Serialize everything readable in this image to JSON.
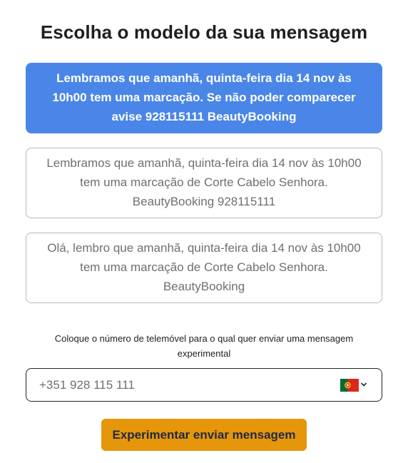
{
  "page": {
    "title": "Escolha o modelo da sua mensagem"
  },
  "templates": [
    {
      "text": "Lembramos que amanhã, quinta-feira dia 14 nov às 10h00 tem uma marcação. Se não poder comparecer avise 928115111 BeautyBooking",
      "selected": true
    },
    {
      "text": "Lembramos que amanhã, quinta-feira dia 14 nov às 10h00 tem uma marcação de Corte Cabelo Senhora. BeautyBooking 928115111",
      "selected": false
    },
    {
      "text": "Olá, lembro que amanhã, quinta-feira dia 14 nov às 10h00 tem uma marcação de Corte Cabelo Senhora. BeautyBooking",
      "selected": false
    }
  ],
  "phone": {
    "label": "Coloque o número de telemóvel para o qual quer enviar uma mensagem experimental",
    "value": "+351 928 115 111",
    "country_flag_icon": "portugal-flag-icon",
    "dropdown_icon": "chevron-down-icon"
  },
  "actions": {
    "send_label": "Experimentar enviar mensagem"
  },
  "colors": {
    "selected_card": "#4a86e8",
    "send_button": "#e6960a",
    "option_border": "#b8b8b8"
  }
}
